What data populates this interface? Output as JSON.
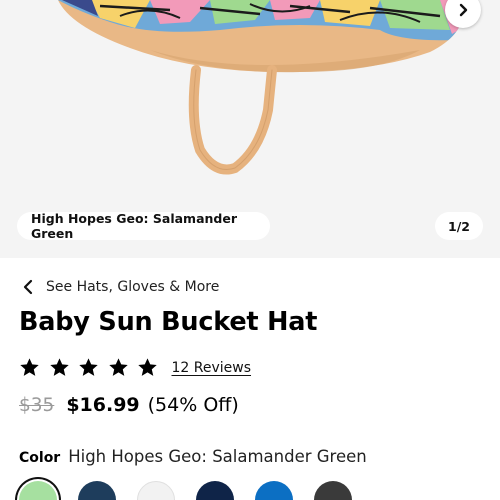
{
  "gallery": {
    "variant_label": "High Hopes Geo: Salamander Green",
    "counter": "1/2",
    "next_icon": "chevron-right-icon"
  },
  "breadcrumb": {
    "label": "See Hats, Gloves & More",
    "icon": "chevron-left-icon"
  },
  "product": {
    "title": "Baby Sun Bucket Hat",
    "rating": 5,
    "reviews_label": "12 Reviews",
    "old_price": "$35",
    "sale_price": "$16.99",
    "discount": "(54% Off)"
  },
  "color": {
    "label": "Color",
    "selected_name": "High Hopes Geo: Salamander Green",
    "swatches": [
      {
        "color": "#a6e0a0",
        "selected": true
      },
      {
        "color": "#1e3d5c",
        "selected": false
      },
      {
        "color": "#f2f2f2",
        "selected": false
      },
      {
        "color": "#0f2448",
        "selected": false
      },
      {
        "color": "#0c6fc3",
        "selected": false
      },
      {
        "color": "#3a3a3a",
        "selected": false
      }
    ]
  },
  "colors": {
    "gallery_bg": "#f4f4f4",
    "hat_tan": "#e9b886",
    "strap": "#e6b27e"
  }
}
